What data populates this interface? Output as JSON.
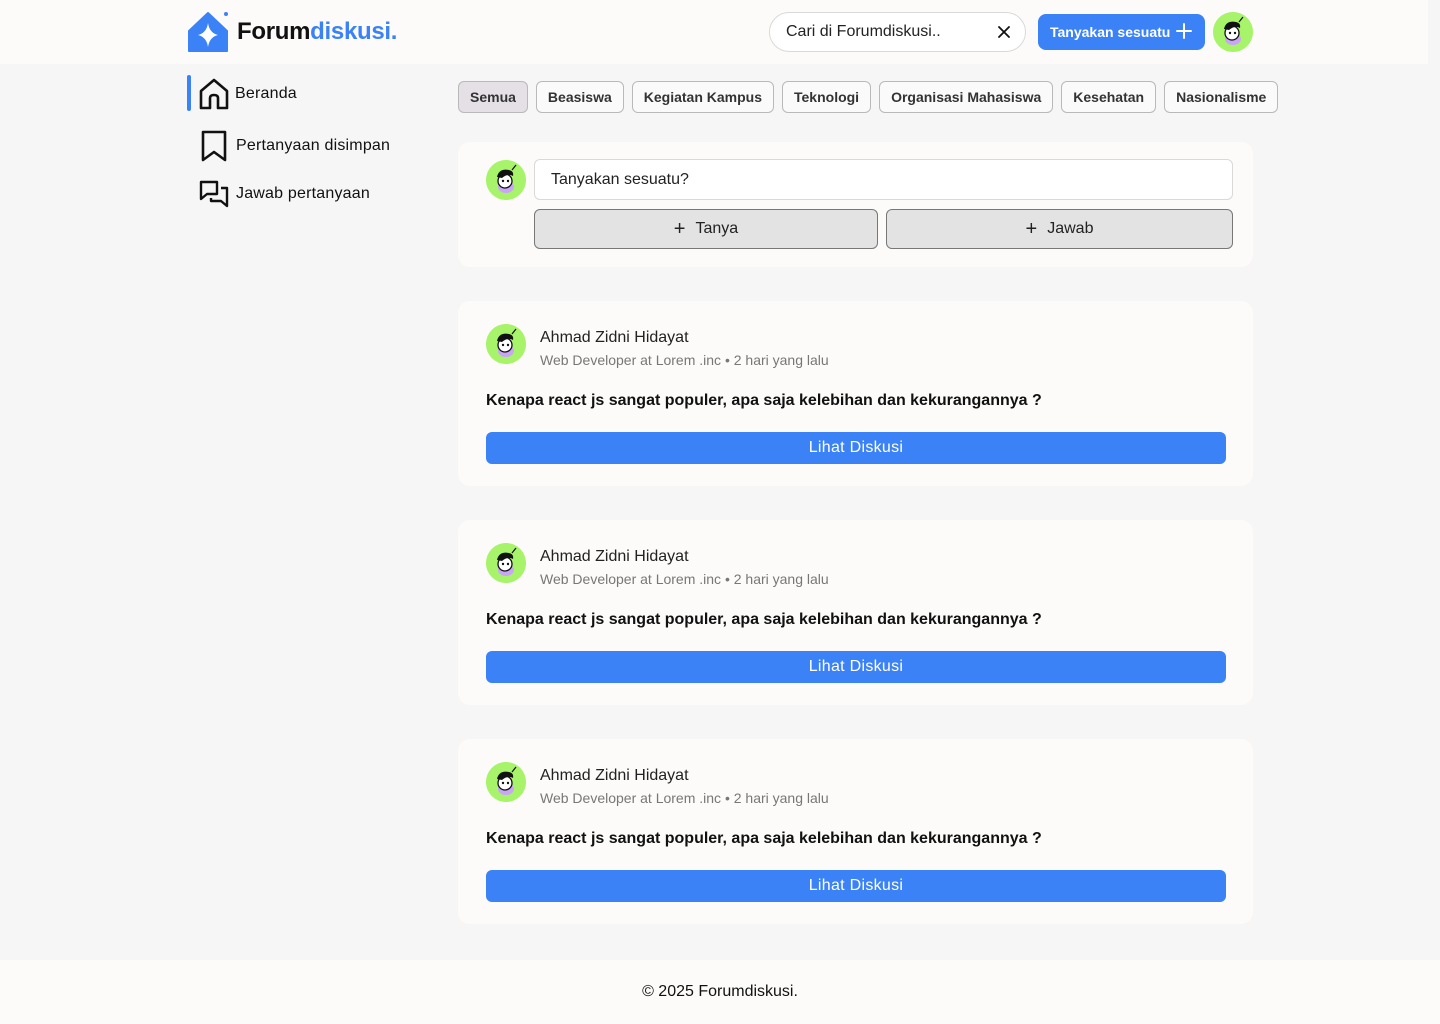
{
  "header": {
    "logo_part1": "Forum",
    "logo_part2": "diskusi.",
    "search_placeholder": "Cari di Forumdiskusi..",
    "ask_button_label": "Tanyakan sesuatu"
  },
  "sidebar": {
    "items": [
      {
        "label": "Beranda",
        "icon": "home-icon",
        "active": true
      },
      {
        "label": "Pertanyaan disimpan",
        "icon": "bookmark-icon",
        "active": false
      },
      {
        "label": "Jawab pertanyaan",
        "icon": "chat-bubbles-icon",
        "active": false
      }
    ]
  },
  "categories": [
    {
      "label": "Semua",
      "active": true
    },
    {
      "label": "Beasiswa",
      "active": false
    },
    {
      "label": "Kegiatan Kampus",
      "active": false
    },
    {
      "label": "Teknologi",
      "active": false
    },
    {
      "label": "Organisasi Mahasiswa",
      "active": false
    },
    {
      "label": "Kesehatan",
      "active": false
    },
    {
      "label": "Nasionalisme",
      "active": false
    }
  ],
  "ask_card": {
    "placeholder": "Tanyakan sesuatu?",
    "ask_button": "Tanya",
    "answer_button": "Jawab"
  },
  "posts": [
    {
      "author": "Ahmad Zidni Hidayat",
      "meta": "Web Developer at Lorem .inc • 2 hari yang lalu",
      "question": "Kenapa react js sangat populer, apa saja kelebihan dan kekurangannya ?",
      "button": "Lihat Diskusi"
    },
    {
      "author": "Ahmad Zidni Hidayat",
      "meta": "Web Developer at Lorem .inc • 2 hari yang lalu",
      "question": "Kenapa react js sangat populer, apa saja kelebihan dan kekurangannya ?",
      "button": "Lihat Diskusi"
    },
    {
      "author": "Ahmad Zidni Hidayat",
      "meta": "Web Developer at Lorem .inc • 2 hari yang lalu",
      "question": "Kenapa react js sangat populer, apa saja kelebihan dan kekurangannya ?",
      "button": "Lihat Diskusi"
    }
  ],
  "footer": {
    "copyright": "© 2025 Forumdiskusi."
  },
  "colors": {
    "accent": "#3b82f6",
    "avatar_bg": "#a7f36a",
    "page_bg": "#f6f6f6",
    "card_bg": "#fcfbf9"
  }
}
